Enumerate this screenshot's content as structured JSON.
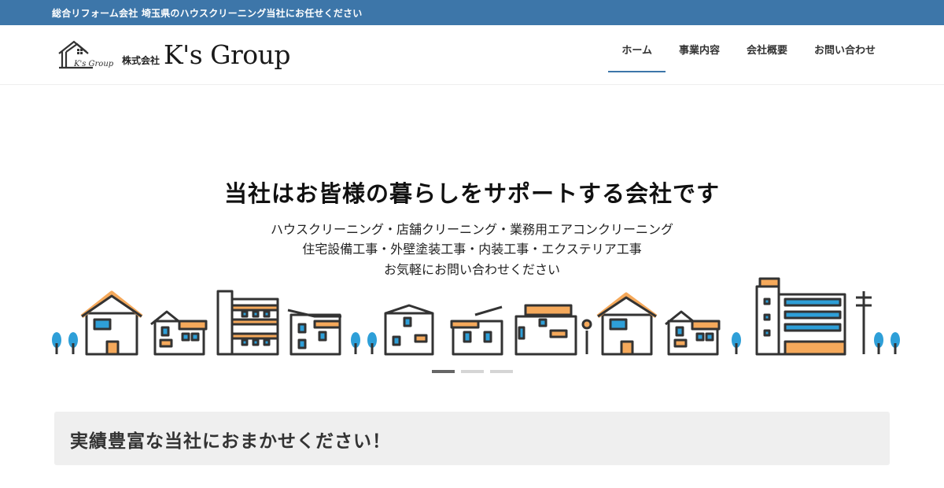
{
  "topbar": {
    "text": "総合リフォーム会社 埼玉県のハウスクリーニング当社にお任せください"
  },
  "logo": {
    "mark_text": "K's Group",
    "kaisha": "株式会社",
    "name": "K's Group"
  },
  "nav": {
    "items": [
      {
        "label": "ホーム",
        "active": true
      },
      {
        "label": "事業内容",
        "active": false
      },
      {
        "label": "会社概要",
        "active": false
      },
      {
        "label": "お問い合わせ",
        "active": false
      }
    ]
  },
  "hero": {
    "title": "当社はお皆様の暮らしをサポートする会社です",
    "lines": [
      "ハウスクリーニング・店舗クリーニング・業務用エアコンクリーニング",
      "住宅設備工事・外壁塗装工事・内装工事・エクステリア工事",
      "お気軽にお問い合わせください"
    ]
  },
  "slider": {
    "count": 3,
    "active_index": 0
  },
  "section": {
    "title": "実績豊富な当社におまかせください！"
  },
  "colors": {
    "topbar": "#3d76a9",
    "nav_underline": "#3d76a9",
    "roof_orange": "#f5a95b",
    "window_blue": "#2e9fd8",
    "outline": "#333333",
    "section_bg": "#efefef"
  }
}
